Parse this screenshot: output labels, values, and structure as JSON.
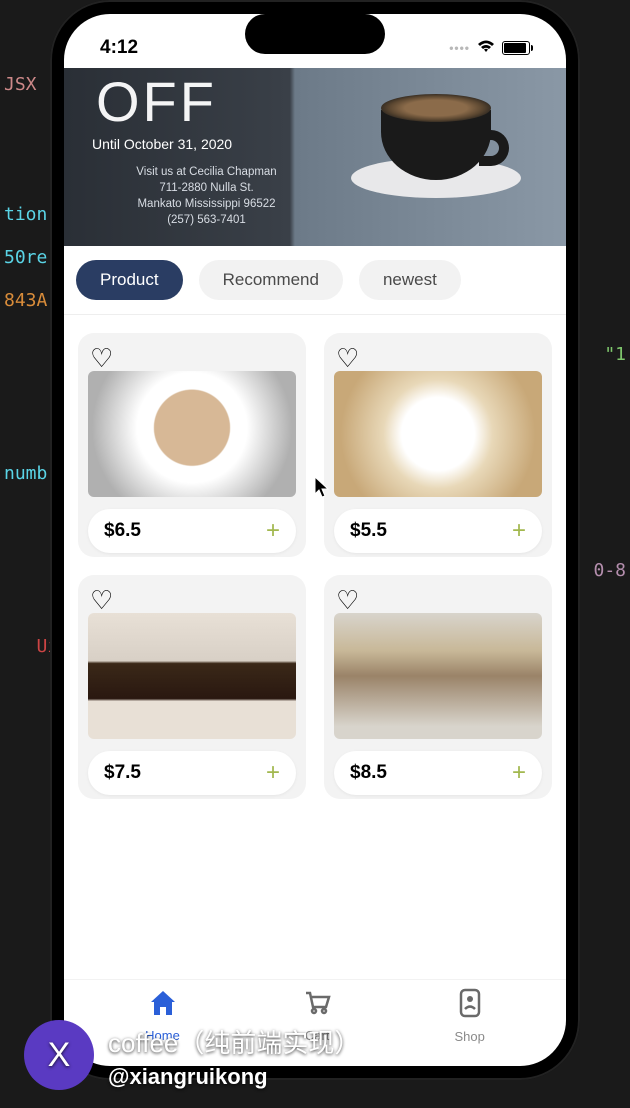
{
  "bg_code": {
    "line1": "tion",
    "line2": "50re",
    "line3": "843A",
    "line4": "numb",
    "line5": "Ui",
    "right1": "\"1",
    "right2": "0-8"
  },
  "status": {
    "time": "4:12"
  },
  "hero": {
    "headline": "OFF",
    "date_label": "Until October 31, 2020",
    "addr1": "Visit us at Cecilia Chapman",
    "addr2": "711-2880 Nulla St.",
    "addr3": "Mankato Mississippi 96522",
    "addr4": "(257) 563-7401"
  },
  "tabs": [
    {
      "label": "Product",
      "active": true
    },
    {
      "label": "Recommend",
      "active": false
    },
    {
      "label": "newest",
      "active": false
    }
  ],
  "products": [
    {
      "price": "$6.5"
    },
    {
      "price": "$5.5"
    },
    {
      "price": "$7.5"
    },
    {
      "price": "$8.5"
    }
  ],
  "tabbar": {
    "home": "Home",
    "cart": "Cart",
    "shop": "Shop"
  },
  "overlay": {
    "avatar_initial": "X",
    "title": "coffee（纯前端实现）",
    "handle": "@xiangruikong"
  }
}
